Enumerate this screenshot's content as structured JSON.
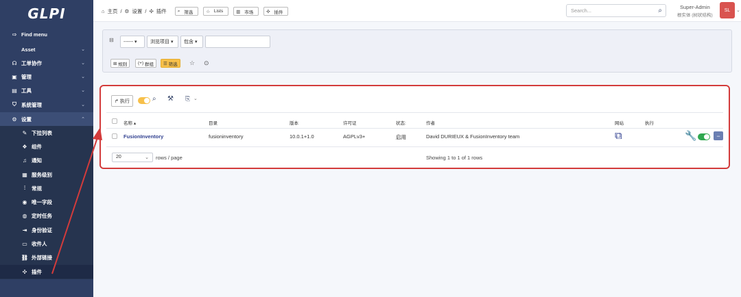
{
  "sidebar": {
    "logo": "GLPI",
    "find_menu": "Find menu",
    "items": [
      {
        "label": "Asset"
      },
      {
        "label": "工单协作"
      },
      {
        "label": "管理"
      },
      {
        "label": "工具"
      },
      {
        "label": "系统管理"
      },
      {
        "label": "设置"
      }
    ],
    "sub_items": [
      {
        "label": "下拉列表"
      },
      {
        "label": "组件"
      },
      {
        "label": "通知"
      },
      {
        "label": "服务级别"
      },
      {
        "label": "常规"
      },
      {
        "label": "唯一字段"
      },
      {
        "label": "定时任务"
      },
      {
        "label": "身份验证"
      },
      {
        "label": "收件人"
      },
      {
        "label": "外部链接"
      },
      {
        "label": "插件"
      }
    ]
  },
  "topbar": {
    "breadcrumb_home": "主页",
    "breadcrumb_settings": "设置",
    "breadcrumb_plugins": "插件",
    "btn_filter": "筛选",
    "btn_lists": "Lists",
    "btn_market": "市场",
    "btn_plugins": "插件",
    "search_placeholder": "Search...",
    "user_name": "Super-Admin",
    "user_entity": "根实体 (树状结构)",
    "avatar_initials": "SL"
  },
  "filter": {
    "field_select": "------",
    "item_select": "浏览项目",
    "op_select": "包含",
    "value": "",
    "btn_rule": "规则",
    "btn_group": "群组",
    "btn_search": "筛选"
  },
  "results": {
    "btn_execute": "执行",
    "columns": [
      "名称",
      "目录",
      "版本",
      "许可证",
      "状态:",
      "作者",
      "网站",
      "执行"
    ],
    "rows": [
      {
        "name": "FusionInventory",
        "directory": "fusioninventory",
        "version": "10.0.1+1.0",
        "license": "AGPLv3+",
        "status": "启用",
        "author": "David DURIEUX & FusionInventory team"
      }
    ],
    "page_size": "20",
    "rows_per_page": "rows / page",
    "showing": "Showing 1 to 1 of 1 rows"
  },
  "colors": {
    "sidebar_bg": "#2f3f64",
    "accent_yellow": "#f7c04a",
    "annotation_red": "#d33b3b",
    "toggle_green": "#2fa84f",
    "link_blue": "#2f3f8f"
  }
}
